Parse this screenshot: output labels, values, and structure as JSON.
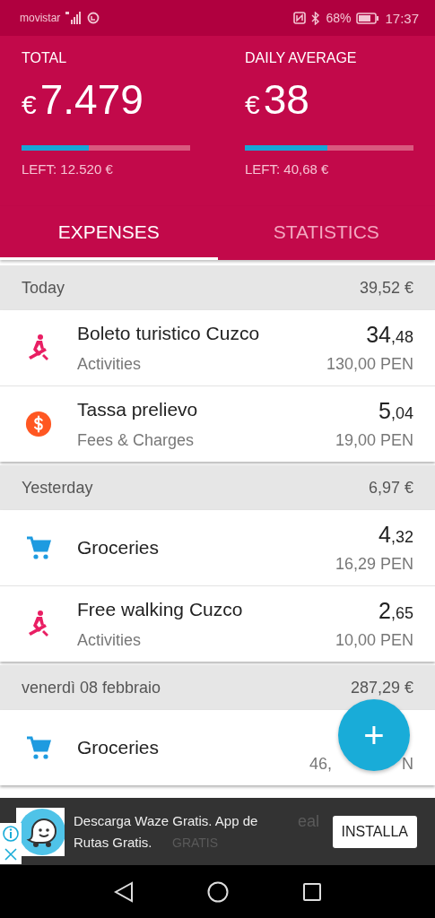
{
  "status_bar": {
    "carrier": "movistar",
    "battery": "68%",
    "time": "17:37"
  },
  "summary": [
    {
      "label": "TOTAL",
      "currency": "€",
      "value": "7.479",
      "level": 0.4,
      "left": "LEFT: 12.520 €"
    },
    {
      "label": "DAILY AVERAGE",
      "currency": "€",
      "value": "38",
      "level": 0.49,
      "left": "LEFT: 40,68 €"
    }
  ],
  "tabs": [
    {
      "label": "EXPENSES",
      "selected": true
    },
    {
      "label": "STATISTICS",
      "selected": false
    }
  ],
  "groups": [
    {
      "title": "Today",
      "total": "39,52 €",
      "rows": [
        {
          "kind": "activities",
          "name": "Boleto turistico Cuzco",
          "category": "Activities",
          "amount": "34$_{,48}$",
          "original": "130,00 PEN"
        },
        {
          "kind": "fees",
          "name": "Tassa prelievo",
          "category": "Fees & Charges",
          "amount": "5$_{,04}$",
          "original": "19,00 PEN"
        }
      ]
    },
    {
      "title": "Yesterday",
      "total": "6,97 €",
      "rows": [
        {
          "kind": "groceries",
          "name": "Groceries",
          "amount": "4$_{,32}$",
          "original": "16,29 PEN"
        },
        {
          "kind": "activities",
          "name": "Free walking Cuzco",
          "category": "Activities",
          "amount": "2$_{,65}$",
          "original": "10,00 PEN"
        }
      ]
    },
    {
      "title": "venerdì 08 febbraio",
      "total": "287,29 €",
      "rows": [
        {
          "kind": "groceries",
          "name": "Groceries",
          "original": "46,",
          "original_tail": "N"
        }
      ]
    }
  ],
  "fab": {
    "label": "+"
  },
  "ad": {
    "text_lines": [
      "Descarga Waze Gratis. App de",
      "Rutas Gratis."
    ],
    "ghost_texts": [
      "eal",
      "GRATIS"
    ],
    "button": "INSTALLA"
  }
}
